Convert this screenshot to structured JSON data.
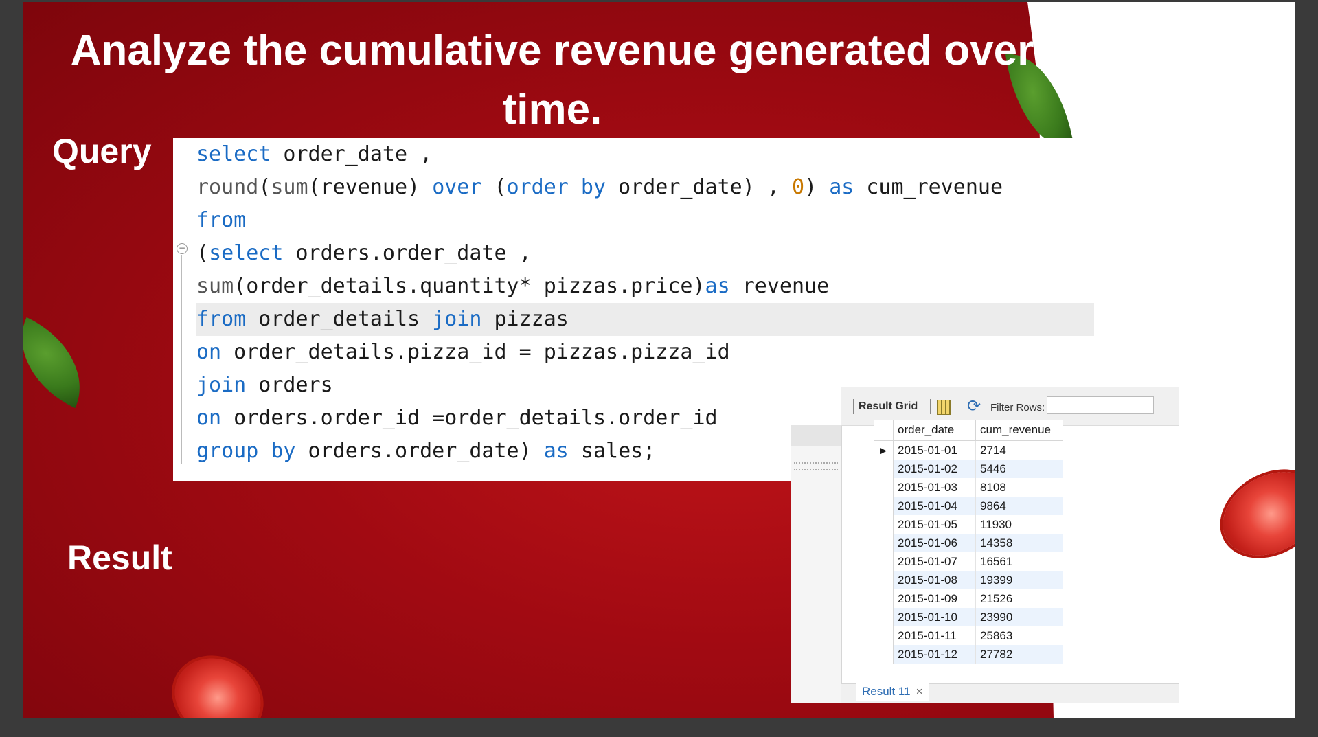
{
  "slide": {
    "title": "Analyze the cumulative revenue generated over time.",
    "query_label": "Query",
    "result_label": "Result"
  },
  "query": {
    "lines": [
      [
        {
          "t": "select",
          "c": "kw"
        },
        {
          "t": " order_date ,",
          "c": ""
        }
      ],
      [
        {
          "t": "round",
          "c": "fn"
        },
        {
          "t": "(",
          "c": ""
        },
        {
          "t": "sum",
          "c": "fn"
        },
        {
          "t": "(revenue) ",
          "c": ""
        },
        {
          "t": "over",
          "c": "kw"
        },
        {
          "t": " (",
          "c": ""
        },
        {
          "t": "order by",
          "c": "kw"
        },
        {
          "t": " order_date) , ",
          "c": ""
        },
        {
          "t": "0",
          "c": "num"
        },
        {
          "t": ") ",
          "c": ""
        },
        {
          "t": "as",
          "c": "kw"
        },
        {
          "t": " cum_revenue",
          "c": ""
        }
      ],
      [
        {
          "t": "from",
          "c": "kw"
        }
      ],
      [
        {
          "t": "(",
          "c": ""
        },
        {
          "t": "select",
          "c": "kw"
        },
        {
          "t": " orders.order_date ,",
          "c": ""
        }
      ],
      [
        {
          "t": "sum",
          "c": "fn"
        },
        {
          "t": "(order_details.quantity* pizzas.price)",
          "c": ""
        },
        {
          "t": "as",
          "c": "kw"
        },
        {
          "t": " revenue",
          "c": ""
        }
      ],
      [
        {
          "t": "from",
          "c": "kw"
        },
        {
          "t": " order_details ",
          "c": ""
        },
        {
          "t": "join",
          "c": "kw"
        },
        {
          "t": " pizzas",
          "c": ""
        }
      ],
      [
        {
          "t": "on",
          "c": "kw"
        },
        {
          "t": " order_details.pizza_id = pizzas.pizza_id",
          "c": ""
        }
      ],
      [
        {
          "t": "join",
          "c": "kw"
        },
        {
          "t": " orders",
          "c": ""
        }
      ],
      [
        {
          "t": "on",
          "c": "kw"
        },
        {
          "t": " orders.order_id =order_details.order_id",
          "c": ""
        }
      ],
      [
        {
          "t": "group by",
          "c": "kw"
        },
        {
          "t": " orders.order_date) ",
          "c": ""
        },
        {
          "t": "as",
          "c": "kw"
        },
        {
          "t": " sales;",
          "c": ""
        }
      ]
    ],
    "highlighted_line": 5
  },
  "result_panel": {
    "toolbar_label": "Result Grid",
    "filter_label": "Filter Rows:",
    "filter_value": "",
    "columns": [
      "order_date",
      "cum_revenue"
    ],
    "rows": [
      [
        "2015-01-01",
        "2714"
      ],
      [
        "2015-01-02",
        "5446"
      ],
      [
        "2015-01-03",
        "8108"
      ],
      [
        "2015-01-04",
        "9864"
      ],
      [
        "2015-01-05",
        "11930"
      ],
      [
        "2015-01-06",
        "14358"
      ],
      [
        "2015-01-07",
        "16561"
      ],
      [
        "2015-01-08",
        "19399"
      ],
      [
        "2015-01-09",
        "21526"
      ],
      [
        "2015-01-10",
        "23990"
      ],
      [
        "2015-01-11",
        "25863"
      ],
      [
        "2015-01-12",
        "27782"
      ]
    ],
    "tab_label": "Result 11",
    "tab_close": "×",
    "row_indicator": "▶"
  },
  "icons": {
    "grid": "result-grid-icon",
    "refresh": "refresh-icon",
    "close": "close-icon"
  },
  "colors": {
    "slide_red": "#a10a12",
    "keyword_blue": "#1a6bc4",
    "number_orange": "#c87800",
    "tab_blue": "#2e6db3"
  }
}
